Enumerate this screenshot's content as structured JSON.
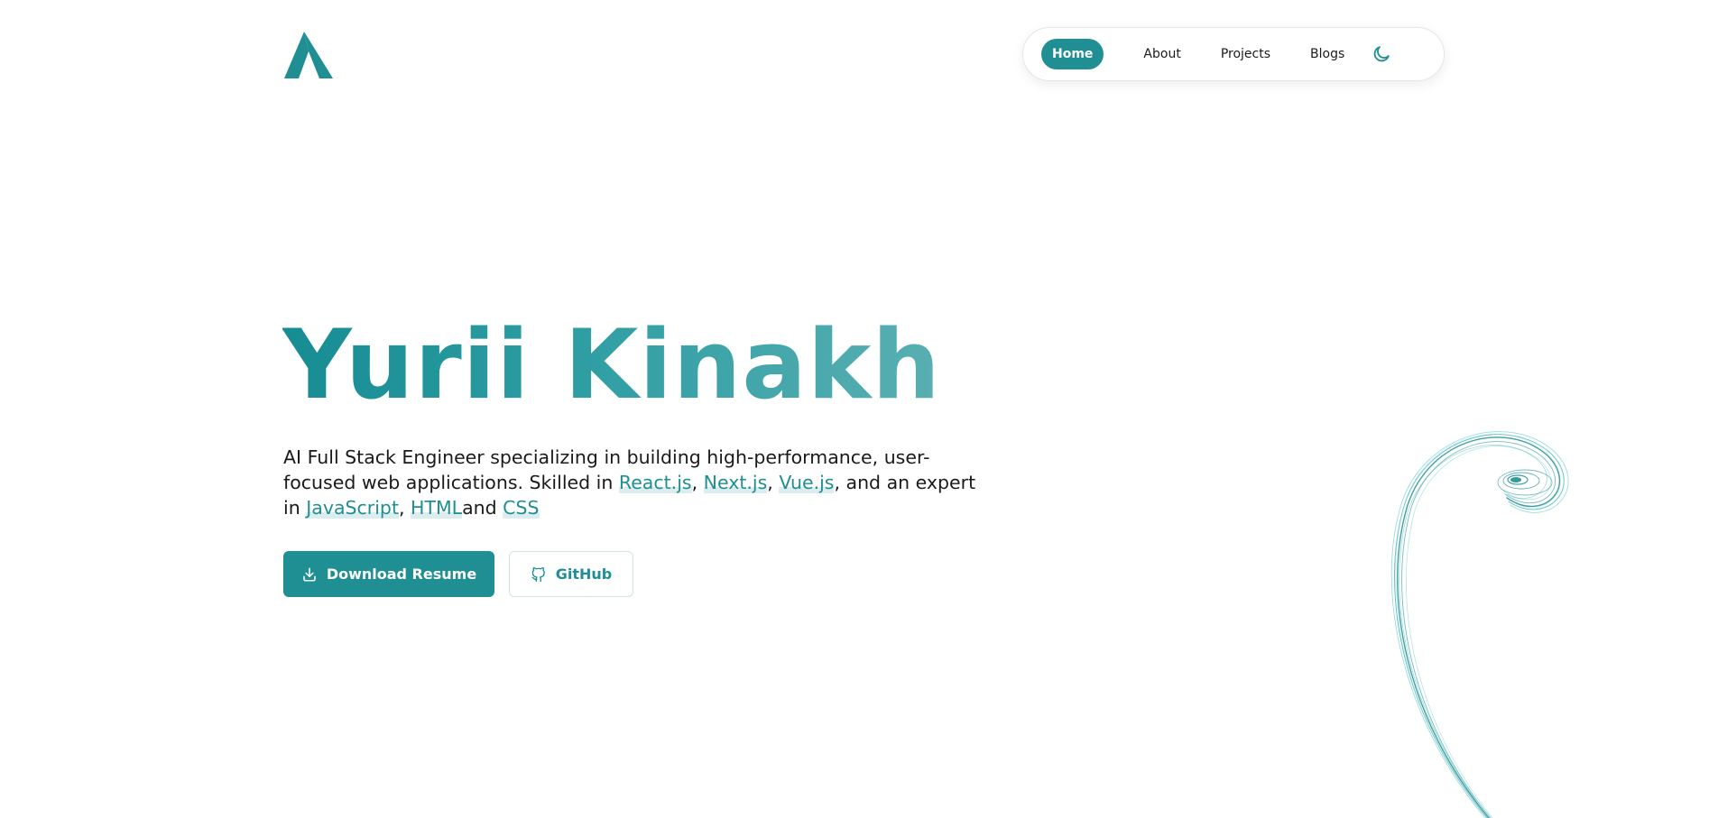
{
  "header": {
    "logo_icon": "a-logo-icon",
    "nav": {
      "items": [
        {
          "label": "Home",
          "active": true
        },
        {
          "label": "About",
          "active": false
        },
        {
          "label": "Projects",
          "active": false
        },
        {
          "label": "Blogs",
          "active": false
        }
      ],
      "theme_toggle_icon": "moon-icon"
    }
  },
  "hero": {
    "name": "Yurii Kinakh",
    "description": {
      "part1": "AI Full Stack Engineer specializing in building high-performance, user-focused web applications. Skilled in ",
      "link1": "React.js",
      "sep1": ", ",
      "link2": "Next.js",
      "sep2": ", ",
      "link3": "Vue.js",
      "part2": ", and an expert in ",
      "link4": "JavaScript",
      "sep3": ", ",
      "link5": "HTML",
      "part3": "and ",
      "link6": "CSS"
    },
    "buttons": {
      "download_label": "Download Resume",
      "download_icon": "download-icon",
      "github_label": "GitHub",
      "github_icon": "github-icon"
    }
  },
  "decoration": {
    "swirl": "teal-swirl-graphic"
  },
  "colors": {
    "accent": "#1f8f94",
    "text": "#1a1a1a",
    "background": "#ffffff"
  }
}
